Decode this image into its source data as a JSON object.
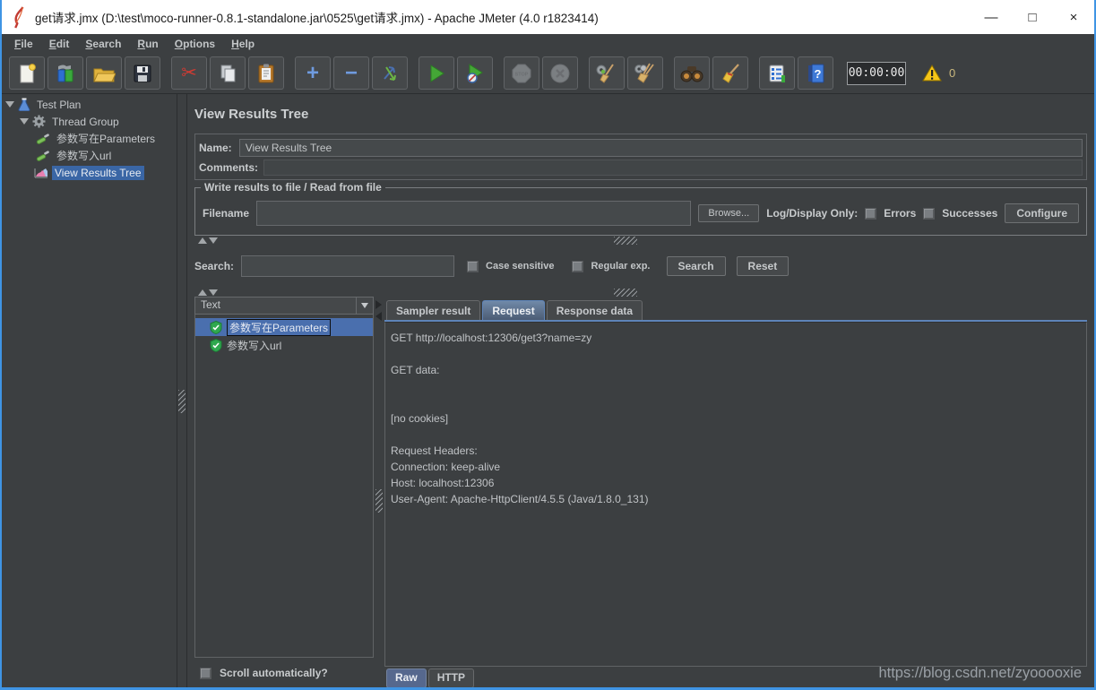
{
  "titlebar": {
    "title": "get请求.jmx (D:\\test\\moco-runner-0.8.1-standalone.jar\\0525\\get请求.jmx) - Apache JMeter (4.0 r1823414)",
    "controls": {
      "minimize": "—",
      "maximize": "□",
      "close": "×"
    }
  },
  "menubar": {
    "items": [
      "File",
      "Edit",
      "Search",
      "Run",
      "Options",
      "Help"
    ]
  },
  "toolbar": {
    "icons": {
      "cut_glyph": "✂",
      "expand_glyph": "+",
      "collapse_glyph": "−",
      "stop_label": "STOP",
      "help_glyph": "?"
    },
    "timer": "00:00:00",
    "warning_count": "0"
  },
  "sidebar": {
    "items": [
      {
        "label": "Test Plan"
      },
      {
        "label": "Thread Group"
      },
      {
        "label": "参数写在Parameters"
      },
      {
        "label": "参数写入url"
      },
      {
        "label": "View Results Tree"
      }
    ]
  },
  "main": {
    "title": "View Results Tree",
    "name": {
      "label": "Name:",
      "value": "View Results Tree"
    },
    "comments": {
      "label": "Comments:",
      "value": ""
    },
    "file_group": {
      "title": "Write results to file / Read from file",
      "filename_label": "Filename",
      "filename_value": "",
      "browse_button": "Browse...",
      "log_display_label": "Log/Display Only:",
      "errors_label": "Errors",
      "successes_label": "Successes",
      "configure_button": "Configure"
    },
    "search_panel": {
      "label": "Search:",
      "value": "",
      "case_sensitive_label": "Case sensitive",
      "regular_exp_label": "Regular exp.",
      "search_button": "Search",
      "reset_button": "Reset"
    },
    "results_panel": {
      "view_selector": "Text",
      "items": [
        {
          "label": "参数写在Parameters"
        },
        {
          "label": "参数写入url"
        }
      ],
      "scroll_label": "Scroll automatically?"
    },
    "detail_tabs": {
      "items": [
        "Sampler result",
        "Request",
        "Response data"
      ],
      "active": "Request"
    },
    "request_text": "GET http://localhost:12306/get3?name=zy\n\nGET data:\n\n\n[no cookies]\n\nRequest Headers:\nConnection: keep-alive\nHost: localhost:12306\nUser-Agent: Apache-HttpClient/4.5.5 (Java/1.8.0_131)",
    "render_tabs": {
      "items": [
        "Raw",
        "HTTP"
      ],
      "active": "Raw"
    }
  },
  "watermark": "https://blog.csdn.net/zyooooxie"
}
